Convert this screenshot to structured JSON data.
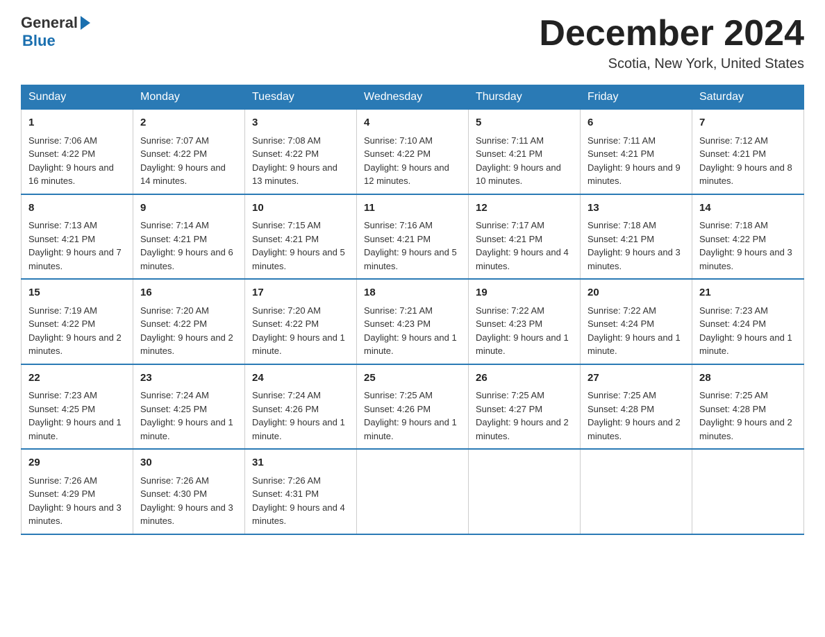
{
  "header": {
    "logo_general": "General",
    "logo_blue": "Blue",
    "month_title": "December 2024",
    "location": "Scotia, New York, United States"
  },
  "days_of_week": [
    "Sunday",
    "Monday",
    "Tuesday",
    "Wednesday",
    "Thursday",
    "Friday",
    "Saturday"
  ],
  "weeks": [
    [
      {
        "day": "1",
        "sunrise": "7:06 AM",
        "sunset": "4:22 PM",
        "daylight": "9 hours and 16 minutes."
      },
      {
        "day": "2",
        "sunrise": "7:07 AM",
        "sunset": "4:22 PM",
        "daylight": "9 hours and 14 minutes."
      },
      {
        "day": "3",
        "sunrise": "7:08 AM",
        "sunset": "4:22 PM",
        "daylight": "9 hours and 13 minutes."
      },
      {
        "day": "4",
        "sunrise": "7:10 AM",
        "sunset": "4:22 PM",
        "daylight": "9 hours and 12 minutes."
      },
      {
        "day": "5",
        "sunrise": "7:11 AM",
        "sunset": "4:21 PM",
        "daylight": "9 hours and 10 minutes."
      },
      {
        "day": "6",
        "sunrise": "7:11 AM",
        "sunset": "4:21 PM",
        "daylight": "9 hours and 9 minutes."
      },
      {
        "day": "7",
        "sunrise": "7:12 AM",
        "sunset": "4:21 PM",
        "daylight": "9 hours and 8 minutes."
      }
    ],
    [
      {
        "day": "8",
        "sunrise": "7:13 AM",
        "sunset": "4:21 PM",
        "daylight": "9 hours and 7 minutes."
      },
      {
        "day": "9",
        "sunrise": "7:14 AM",
        "sunset": "4:21 PM",
        "daylight": "9 hours and 6 minutes."
      },
      {
        "day": "10",
        "sunrise": "7:15 AM",
        "sunset": "4:21 PM",
        "daylight": "9 hours and 5 minutes."
      },
      {
        "day": "11",
        "sunrise": "7:16 AM",
        "sunset": "4:21 PM",
        "daylight": "9 hours and 5 minutes."
      },
      {
        "day": "12",
        "sunrise": "7:17 AM",
        "sunset": "4:21 PM",
        "daylight": "9 hours and 4 minutes."
      },
      {
        "day": "13",
        "sunrise": "7:18 AM",
        "sunset": "4:21 PM",
        "daylight": "9 hours and 3 minutes."
      },
      {
        "day": "14",
        "sunrise": "7:18 AM",
        "sunset": "4:22 PM",
        "daylight": "9 hours and 3 minutes."
      }
    ],
    [
      {
        "day": "15",
        "sunrise": "7:19 AM",
        "sunset": "4:22 PM",
        "daylight": "9 hours and 2 minutes."
      },
      {
        "day": "16",
        "sunrise": "7:20 AM",
        "sunset": "4:22 PM",
        "daylight": "9 hours and 2 minutes."
      },
      {
        "day": "17",
        "sunrise": "7:20 AM",
        "sunset": "4:22 PM",
        "daylight": "9 hours and 1 minute."
      },
      {
        "day": "18",
        "sunrise": "7:21 AM",
        "sunset": "4:23 PM",
        "daylight": "9 hours and 1 minute."
      },
      {
        "day": "19",
        "sunrise": "7:22 AM",
        "sunset": "4:23 PM",
        "daylight": "9 hours and 1 minute."
      },
      {
        "day": "20",
        "sunrise": "7:22 AM",
        "sunset": "4:24 PM",
        "daylight": "9 hours and 1 minute."
      },
      {
        "day": "21",
        "sunrise": "7:23 AM",
        "sunset": "4:24 PM",
        "daylight": "9 hours and 1 minute."
      }
    ],
    [
      {
        "day": "22",
        "sunrise": "7:23 AM",
        "sunset": "4:25 PM",
        "daylight": "9 hours and 1 minute."
      },
      {
        "day": "23",
        "sunrise": "7:24 AM",
        "sunset": "4:25 PM",
        "daylight": "9 hours and 1 minute."
      },
      {
        "day": "24",
        "sunrise": "7:24 AM",
        "sunset": "4:26 PM",
        "daylight": "9 hours and 1 minute."
      },
      {
        "day": "25",
        "sunrise": "7:25 AM",
        "sunset": "4:26 PM",
        "daylight": "9 hours and 1 minute."
      },
      {
        "day": "26",
        "sunrise": "7:25 AM",
        "sunset": "4:27 PM",
        "daylight": "9 hours and 2 minutes."
      },
      {
        "day": "27",
        "sunrise": "7:25 AM",
        "sunset": "4:28 PM",
        "daylight": "9 hours and 2 minutes."
      },
      {
        "day": "28",
        "sunrise": "7:25 AM",
        "sunset": "4:28 PM",
        "daylight": "9 hours and 2 minutes."
      }
    ],
    [
      {
        "day": "29",
        "sunrise": "7:26 AM",
        "sunset": "4:29 PM",
        "daylight": "9 hours and 3 minutes."
      },
      {
        "day": "30",
        "sunrise": "7:26 AM",
        "sunset": "4:30 PM",
        "daylight": "9 hours and 3 minutes."
      },
      {
        "day": "31",
        "sunrise": "7:26 AM",
        "sunset": "4:31 PM",
        "daylight": "9 hours and 4 minutes."
      },
      null,
      null,
      null,
      null
    ]
  ]
}
